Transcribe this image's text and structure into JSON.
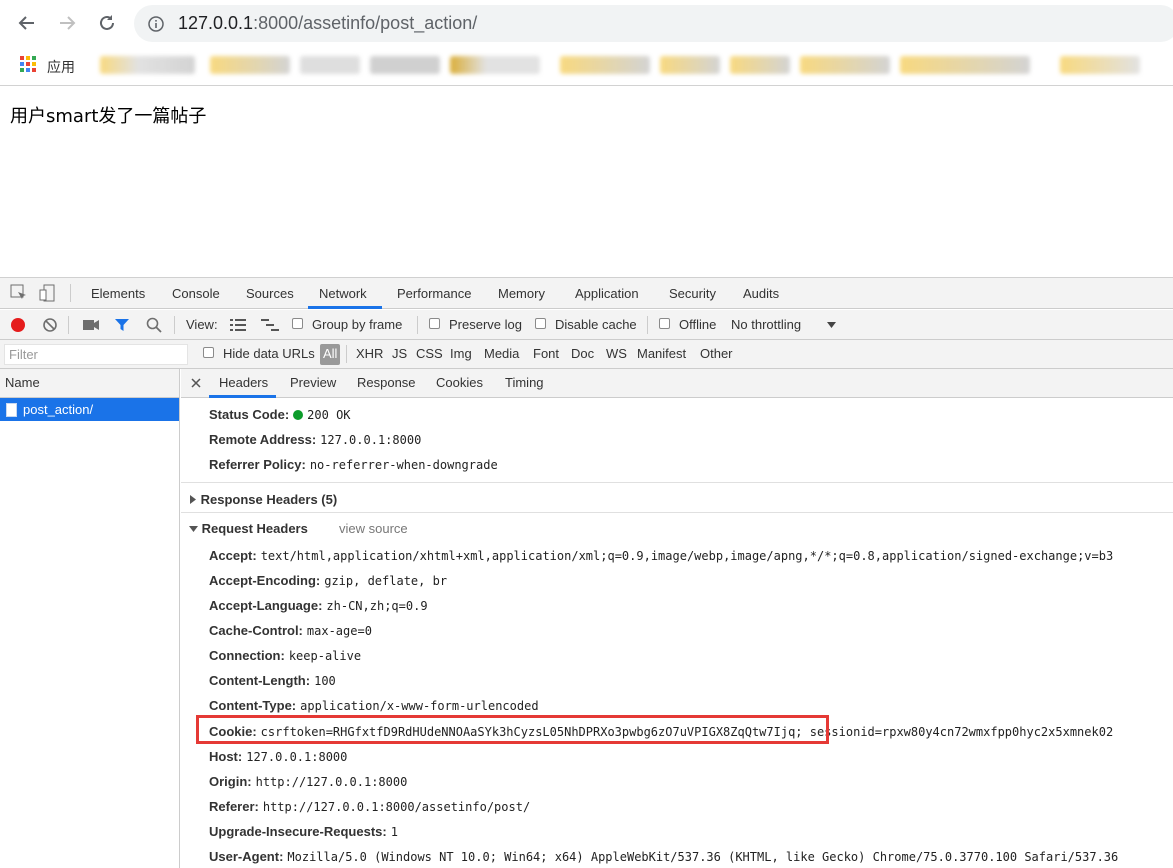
{
  "browser": {
    "url_host": "127.0.0.1",
    "url_path": ":8000/assetinfo/post_action/",
    "apps_label": "应用"
  },
  "page": {
    "text": "用户smart发了一篇帖子"
  },
  "devtools": {
    "tabs": [
      "Elements",
      "Console",
      "Sources",
      "Network",
      "Performance",
      "Memory",
      "Application",
      "Security",
      "Audits"
    ],
    "active_tab": "Network",
    "toolbar": {
      "view_label": "View:",
      "group_by_frame": "Group by frame",
      "preserve_log": "Preserve log",
      "disable_cache": "Disable cache",
      "offline": "Offline",
      "throttling": "No throttling"
    },
    "filter": {
      "placeholder": "Filter",
      "hide_data_urls": "Hide data URLs",
      "types": [
        "All",
        "XHR",
        "JS",
        "CSS",
        "Img",
        "Media",
        "Font",
        "Doc",
        "WS",
        "Manifest",
        "Other"
      ]
    },
    "name_pane": {
      "header": "Name",
      "selected_request": "post_action/"
    },
    "detail_tabs": [
      "Headers",
      "Preview",
      "Response",
      "Cookies",
      "Timing"
    ],
    "general": [
      {
        "key": "Status Code:",
        "value": "200 OK"
      },
      {
        "key": "Remote Address:",
        "value": "127.0.0.1:8000"
      },
      {
        "key": "Referrer Policy:",
        "value": "no-referrer-when-downgrade"
      }
    ],
    "response_headers_title": "Response Headers (5)",
    "request_headers_title": "Request Headers",
    "view_source": "view source",
    "request_headers": [
      {
        "key": "Accept:",
        "value": "text/html,application/xhtml+xml,application/xml;q=0.9,image/webp,image/apng,*/*;q=0.8,application/signed-exchange;v=b3"
      },
      {
        "key": "Accept-Encoding:",
        "value": "gzip, deflate, br"
      },
      {
        "key": "Accept-Language:",
        "value": "zh-CN,zh;q=0.9"
      },
      {
        "key": "Cache-Control:",
        "value": "max-age=0"
      },
      {
        "key": "Connection:",
        "value": "keep-alive"
      },
      {
        "key": "Content-Length:",
        "value": "100"
      },
      {
        "key": "Content-Type:",
        "value": "application/x-www-form-urlencoded"
      },
      {
        "key": "Cookie:",
        "value": "csrftoken=RHGfxtfD9RdHUdeNNOAaSYk3hCyzsL05NhDPRXo3pwbg6zO7uVPIGX8ZqQtw7Ijq; sessionid=rpxw80y4cn72wmxfpp0hyc2x5xmnek02"
      },
      {
        "key": "Host:",
        "value": "127.0.0.1:8000"
      },
      {
        "key": "Origin:",
        "value": "http://127.0.0.1:8000"
      },
      {
        "key": "Referer:",
        "value": "http://127.0.0.1:8000/assetinfo/post/"
      },
      {
        "key": "Upgrade-Insecure-Requests:",
        "value": "1"
      },
      {
        "key": "User-Agent:",
        "value": "Mozilla/5.0 (Windows NT 10.0; Win64; x64) AppleWebKit/537.36 (KHTML, like Gecko) Chrome/75.0.3770.100 Safari/537.36"
      }
    ],
    "colors": {
      "accent": "#1a73e8",
      "record": "#e51c1c",
      "status_ok": "#0c9c2b",
      "highlight_box": "#e53935"
    }
  }
}
